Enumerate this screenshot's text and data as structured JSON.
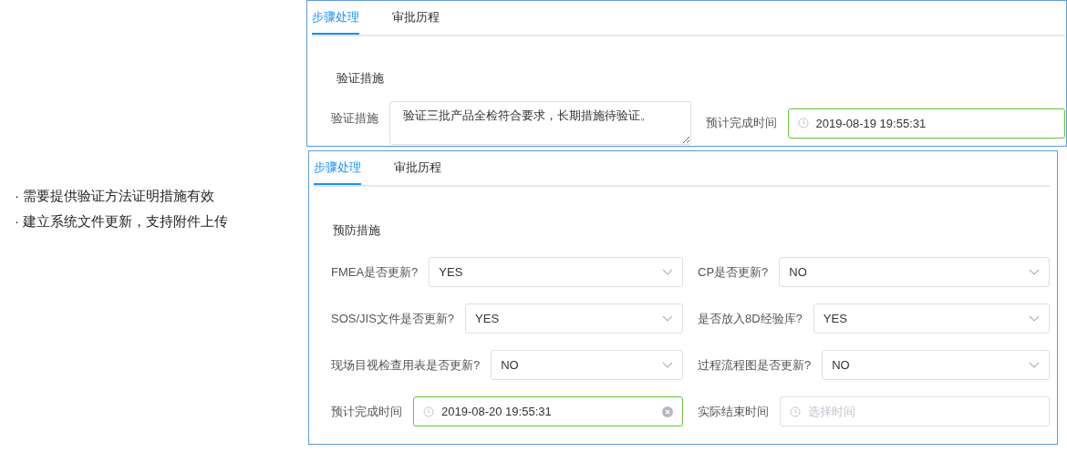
{
  "notes": [
    "· 需要提供验证方法证明措施有效",
    "· 建立系统文件更新，支持附件上传"
  ],
  "panels": [
    {
      "tabs": [
        {
          "label": "步骤处理",
          "selected": true
        },
        {
          "label": "审批历程",
          "selected": false
        }
      ],
      "section_title": "验证措施",
      "fields": [
        {
          "kind": "textarea",
          "label": "验证措施",
          "value": "验证三批产品全检符合要求，长期措施待验证。",
          "focused": false
        },
        {
          "kind": "datetime",
          "label": "预计完成时间",
          "value": "2019-08-19 19:55:31",
          "focused": true,
          "clearable": false
        }
      ]
    },
    {
      "tabs": [
        {
          "label": "步骤处理",
          "selected": true
        },
        {
          "label": "审批历程",
          "selected": false
        }
      ],
      "section_title": "预防措施",
      "fields": [
        {
          "kind": "select",
          "label": "FMEA是否更新?",
          "value": "YES",
          "focused": false
        },
        {
          "kind": "select",
          "label": "CP是否更新?",
          "value": "NO",
          "focused": false
        },
        {
          "kind": "select",
          "label": "SOS/JIS文件是否更新?",
          "value": "YES",
          "focused": false
        },
        {
          "kind": "select",
          "label": "是否放入8D经验库?",
          "value": "YES",
          "focused": false
        },
        {
          "kind": "select",
          "label": "现场目视检查用表是否更新?",
          "value": "NO",
          "focused": false
        },
        {
          "kind": "select",
          "label": "过程流程图是否更新?",
          "value": "NO",
          "focused": false
        },
        {
          "kind": "datetime",
          "label": "预计完成时间",
          "value": "2019-08-20 19:55:31",
          "focused": true,
          "clearable": true
        },
        {
          "kind": "datetime",
          "label": "实际结束时间",
          "placeholder": "选择时间",
          "focused": false,
          "clearable": false
        }
      ]
    }
  ]
}
